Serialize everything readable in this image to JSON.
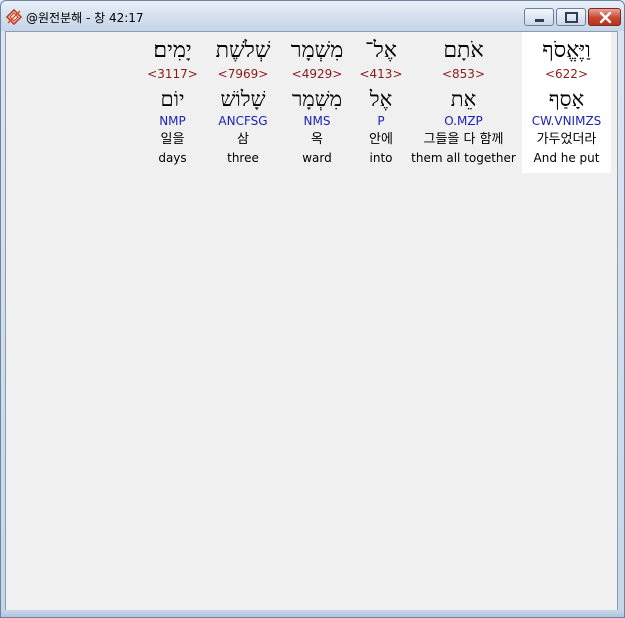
{
  "window": {
    "title": "@원전분해 - 창 42:17",
    "controls": {
      "minimize": "minimize",
      "maximize": "maximize",
      "close": "close"
    },
    "colors": {
      "strong_number": "#8b1a1a",
      "morphology": "#1c22b8",
      "selected_background": "#ffffff"
    }
  },
  "words": [
    {
      "hebrew": "יָמִים׃",
      "strong": "<3117>",
      "lemma": "יוֹם",
      "morph": "NMP",
      "korean": "일을",
      "english": "days"
    },
    {
      "hebrew": "שְׁלֹשֶׁת",
      "strong": "<7969>",
      "lemma": "שָׁלוֹשׁ",
      "morph": "ANCFSG",
      "korean": "삼",
      "english": "three"
    },
    {
      "hebrew": "מִשְׁמָר",
      "strong": "<4929>",
      "lemma": "מִשְׁמָר",
      "morph": "NMS",
      "korean": "옥",
      "english": "ward"
    },
    {
      "hebrew": "אֶל־",
      "strong": "<413>",
      "lemma": "אֶל",
      "morph": "P",
      "korean": "안에",
      "english": "into"
    },
    {
      "hebrew": "אֹתָם",
      "strong": "<853>",
      "lemma": "אֵת",
      "morph": "O.MZP",
      "korean": "그들을 다 함께",
      "english": "them all together"
    },
    {
      "hebrew": "וַיֶּאֱסֹף",
      "strong": "<622>",
      "lemma": "אָסַף",
      "morph": "CW.VNIMZS",
      "korean": "가두었더라",
      "english": "And he put",
      "selected": true
    }
  ]
}
